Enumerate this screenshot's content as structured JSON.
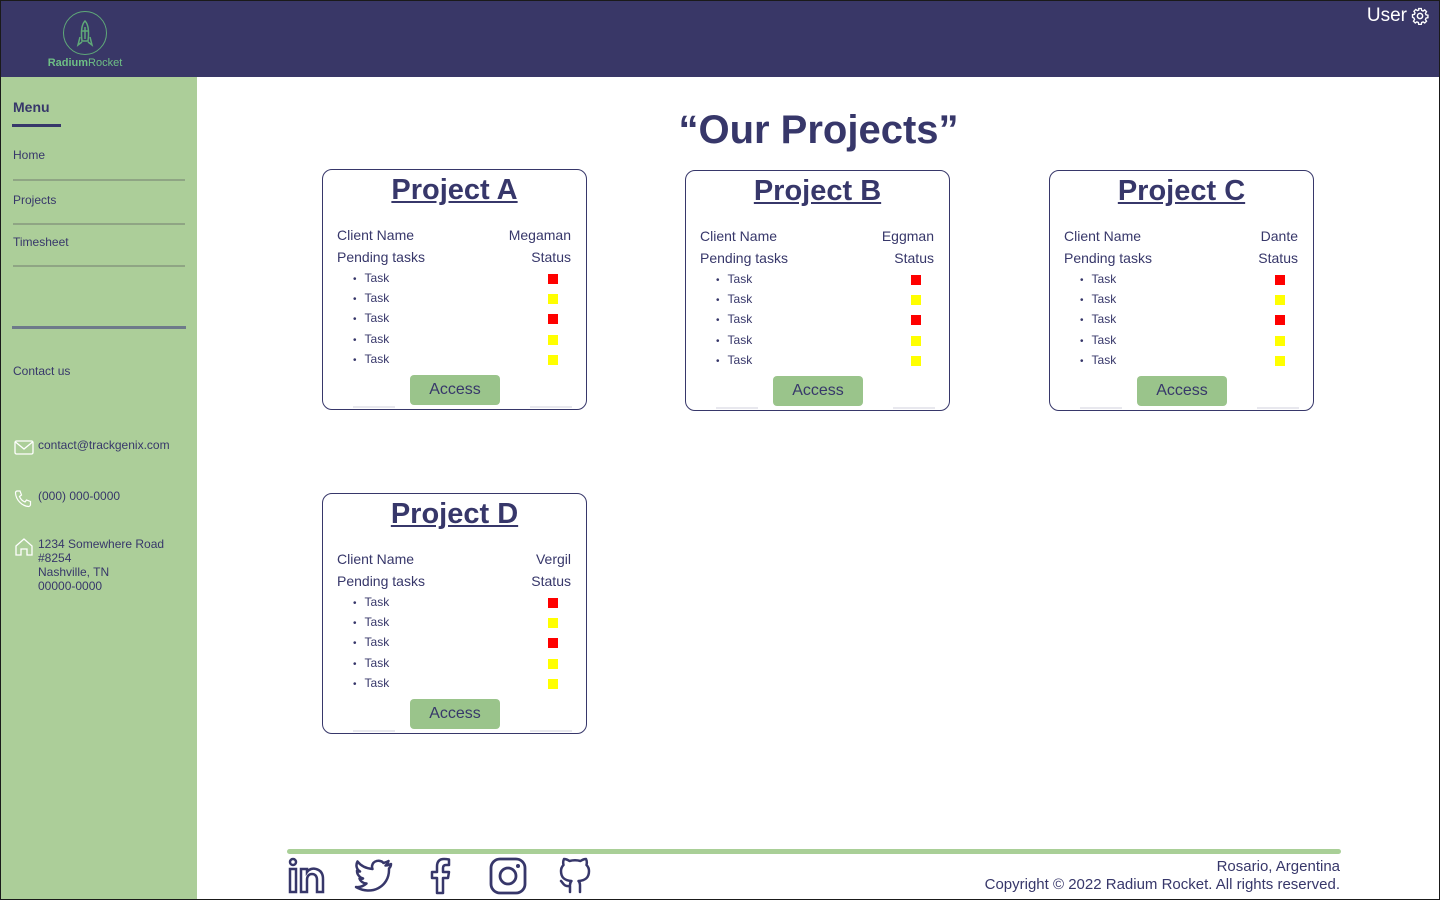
{
  "header": {
    "logo_text_bold": "Radium",
    "logo_text_light": "Rocket",
    "user_label": "User"
  },
  "sidebar": {
    "menu_title": "Menu",
    "items": [
      {
        "label": "Home"
      },
      {
        "label": "Projects"
      },
      {
        "label": "Timesheet"
      }
    ],
    "contact_title": "Contact us",
    "email": "contact@trackgenix.com",
    "phone": "(000) 000-0000",
    "address": [
      "1234 Somewhere Road",
      "#8254",
      "Nashville, TN",
      "00000-0000"
    ]
  },
  "main": {
    "title": "“Our Projects”",
    "projects": [
      {
        "name": "Project A",
        "client_label": "Client Name",
        "client": "Megaman",
        "pending_label": "Pending tasks",
        "status_label": "Status",
        "tasks": [
          {
            "label": "Task",
            "status_color": "#ff0000"
          },
          {
            "label": "Task",
            "status_color": "#ffff00"
          },
          {
            "label": "Task",
            "status_color": "#ff0000"
          },
          {
            "label": "Task",
            "status_color": "#ffff00"
          },
          {
            "label": "Task",
            "status_color": "#ffff00"
          }
        ],
        "button": "Access"
      },
      {
        "name": "Project B",
        "client_label": "Client Name",
        "client": "Eggman",
        "pending_label": "Pending tasks",
        "status_label": "Status",
        "tasks": [
          {
            "label": "Task",
            "status_color": "#ff0000"
          },
          {
            "label": "Task",
            "status_color": "#ffff00"
          },
          {
            "label": "Task",
            "status_color": "#ff0000"
          },
          {
            "label": "Task",
            "status_color": "#ffff00"
          },
          {
            "label": "Task",
            "status_color": "#ffff00"
          }
        ],
        "button": "Access"
      },
      {
        "name": "Project C",
        "client_label": "Client Name",
        "client": "Dante",
        "pending_label": "Pending tasks",
        "status_label": "Status",
        "tasks": [
          {
            "label": "Task",
            "status_color": "#ff0000"
          },
          {
            "label": "Task",
            "status_color": "#ffff00"
          },
          {
            "label": "Task",
            "status_color": "#ff0000"
          },
          {
            "label": "Task",
            "status_color": "#ffff00"
          },
          {
            "label": "Task",
            "status_color": "#ffff00"
          }
        ],
        "button": "Access"
      },
      {
        "name": "Project D",
        "client_label": "Client Name",
        "client": "Vergil",
        "pending_label": "Pending tasks",
        "status_label": "Status",
        "tasks": [
          {
            "label": "Task",
            "status_color": "#ff0000"
          },
          {
            "label": "Task",
            "status_color": "#ffff00"
          },
          {
            "label": "Task",
            "status_color": "#ff0000"
          },
          {
            "label": "Task",
            "status_color": "#ffff00"
          },
          {
            "label": "Task",
            "status_color": "#ffff00"
          }
        ],
        "button": "Access"
      }
    ]
  },
  "footer": {
    "socials": [
      "linkedin-icon",
      "twitter-icon",
      "facebook-icon",
      "instagram-icon",
      "github-icon"
    ],
    "location": "Rosario, Argentina",
    "copyright": "Copyright © 2022 Radium Rocket. All rights reserved."
  },
  "colors": {
    "header_bg": "#393767",
    "sidebar_bg": "#acce99",
    "primary_text": "#37376a",
    "button_bg": "#9ac48b",
    "status_red": "#ff0000",
    "status_yellow": "#ffff00"
  }
}
